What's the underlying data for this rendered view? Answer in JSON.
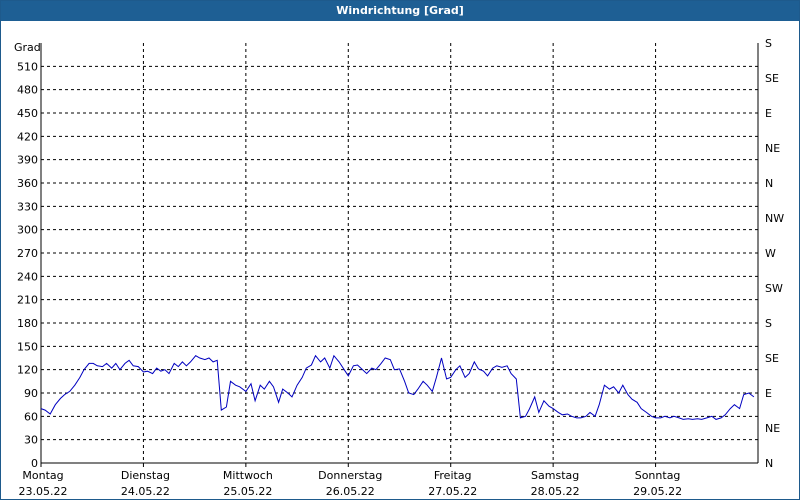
{
  "title": "Windrichtung [Grad]",
  "colors": {
    "titlebar": "#1e5f94",
    "line": "#0000c0",
    "grid": "#000000"
  },
  "chart_data": {
    "type": "line",
    "title": "Windrichtung [Grad]",
    "ylabel": "Grad",
    "ylim": [
      0,
      540
    ],
    "grid": true,
    "yticks": [
      0,
      30,
      60,
      90,
      120,
      150,
      180,
      210,
      240,
      270,
      300,
      330,
      360,
      390,
      420,
      450,
      480,
      510
    ],
    "right_ticks": [
      {
        "value": 0,
        "label": "N"
      },
      {
        "value": 45,
        "label": "NE"
      },
      {
        "value": 90,
        "label": "E"
      },
      {
        "value": 135,
        "label": "SE"
      },
      {
        "value": 180,
        "label": "S"
      },
      {
        "value": 225,
        "label": "SW"
      },
      {
        "value": 270,
        "label": "W"
      },
      {
        "value": 315,
        "label": "NW"
      },
      {
        "value": 360,
        "label": "N"
      },
      {
        "value": 405,
        "label": "NE"
      },
      {
        "value": 450,
        "label": "E"
      },
      {
        "value": 495,
        "label": "SE"
      },
      {
        "value": 540,
        "label": "S"
      }
    ],
    "xlim": [
      0,
      7
    ],
    "xticks": [
      {
        "day": "Montag",
        "date": "23.05.22",
        "value": 0
      },
      {
        "day": "Dienstag",
        "date": "24.05.22",
        "value": 1
      },
      {
        "day": "Mittwoch",
        "date": "25.05.22",
        "value": 2
      },
      {
        "day": "Donnerstag",
        "date": "26.05.22",
        "value": 3
      },
      {
        "day": "Freitag",
        "date": "27.05.22",
        "value": 4
      },
      {
        "day": "Samstag",
        "date": "28.05.22",
        "value": 5
      },
      {
        "day": "Sonntag",
        "date": "29.05.22",
        "value": 6
      }
    ],
    "x": [
      0.0,
      0.04,
      0.09,
      0.14,
      0.19,
      0.23,
      0.28,
      0.33,
      0.38,
      0.42,
      0.47,
      0.51,
      0.55,
      0.6,
      0.64,
      0.69,
      0.73,
      0.77,
      0.82,
      0.86,
      0.9,
      0.95,
      1.0,
      1.04,
      1.09,
      1.13,
      1.17,
      1.21,
      1.25,
      1.3,
      1.34,
      1.38,
      1.42,
      1.46,
      1.51,
      1.55,
      1.6,
      1.64,
      1.68,
      1.72,
      1.76,
      1.81,
      1.85,
      1.9,
      1.94,
      2.0,
      2.05,
      2.09,
      2.14,
      2.18,
      2.23,
      2.27,
      2.32,
      2.36,
      2.41,
      2.45,
      2.5,
      2.55,
      2.59,
      2.64,
      2.68,
      2.73,
      2.77,
      2.82,
      2.86,
      2.91,
      2.96,
      3.0,
      3.05,
      3.09,
      3.14,
      3.18,
      3.23,
      3.27,
      3.32,
      3.36,
      3.41,
      3.45,
      3.5,
      3.55,
      3.59,
      3.64,
      3.68,
      3.73,
      3.77,
      3.82,
      3.86,
      3.91,
      3.96,
      4.0,
      4.05,
      4.09,
      4.14,
      4.18,
      4.23,
      4.27,
      4.32,
      4.36,
      4.41,
      4.45,
      4.5,
      4.55,
      4.59,
      4.64,
      4.68,
      4.73,
      4.77,
      4.82,
      4.86,
      4.91,
      4.96,
      5.0,
      5.05,
      5.09,
      5.14,
      5.18,
      5.23,
      5.27,
      5.32,
      5.36,
      5.41,
      5.45,
      5.5,
      5.55,
      5.59,
      5.64,
      5.68,
      5.73,
      5.77,
      5.82,
      5.86,
      5.91,
      5.96,
      6.0,
      6.05,
      6.09,
      6.14,
      6.18,
      6.23,
      6.27,
      6.32,
      6.36,
      6.41,
      6.45,
      6.5,
      6.55,
      6.59,
      6.64,
      6.68,
      6.73,
      6.77,
      6.82,
      6.86,
      6.91,
      6.96
    ],
    "series": [
      {
        "values": [
          70,
          68,
          63,
          75,
          83,
          88,
          92,
          100,
          110,
          120,
          128,
          128,
          125,
          124,
          128,
          122,
          128,
          120,
          128,
          132,
          125,
          124,
          117,
          118,
          115,
          122,
          118,
          120,
          115,
          128,
          124,
          130,
          125,
          130,
          138,
          135,
          133,
          135,
          130,
          132,
          68,
          72,
          105,
          100,
          98,
          92,
          102,
          80,
          100,
          95,
          105,
          98,
          78,
          95,
          90,
          85,
          100,
          110,
          122,
          126,
          138,
          130,
          135,
          122,
          138,
          130,
          120,
          112,
          125,
          126,
          120,
          115,
          122,
          120,
          128,
          135,
          133,
          120,
          121,
          105,
          90,
          88,
          95,
          105,
          100,
          92,
          110,
          135,
          108,
          110,
          120,
          125,
          110,
          115,
          130,
          121,
          118,
          112,
          122,
          125,
          123,
          125,
          115,
          108,
          58,
          60,
          70,
          85,
          65,
          80,
          73,
          70,
          65,
          62,
          63,
          60,
          58,
          58,
          60,
          65,
          60,
          75,
          100,
          95,
          98,
          90,
          100,
          88,
          82,
          78,
          70,
          65,
          60,
          58,
          58,
          60,
          58,
          60,
          58,
          56,
          57,
          56,
          57,
          56,
          58,
          60,
          56,
          58,
          62,
          70,
          75,
          70,
          88,
          90,
          85
        ]
      }
    ]
  }
}
